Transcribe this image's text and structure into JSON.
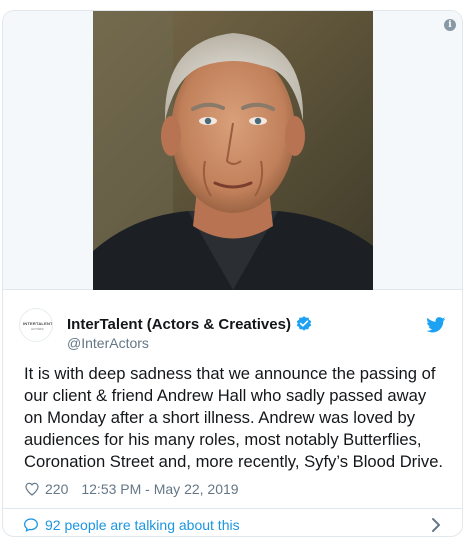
{
  "media": {
    "image_alt": "Portrait photo of Andrew Hall",
    "info_icon": "info-icon"
  },
  "account": {
    "display_name": "InterTalent (Actors & Creatives)",
    "handle": "@InterActors",
    "avatar_logo_top": "INTERTALENT",
    "avatar_logo_bottom": "ACTORS",
    "verified_icon": "verified-badge-icon",
    "brand_icon": "twitter-bird-icon",
    "brand_color": "#1da1f2"
  },
  "tweet": {
    "text": "It is with deep sadness that we announce the passing of our client & friend Andrew Hall who sadly passed away on Monday after a short illness. Andrew was loved by audiences for his many roles, most notably Butterflies, Coronation Street and, more recently, Syfy’s Blood Drive.",
    "likes": "220",
    "timestamp": "12:53 PM - May 22, 2019"
  },
  "footer": {
    "talking_label": "92 people are talking about this",
    "link_color": "#1b95e0"
  }
}
